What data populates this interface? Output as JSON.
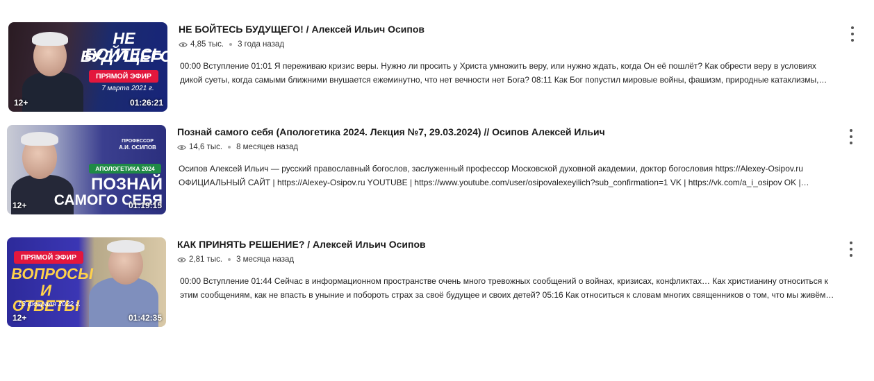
{
  "videos": [
    {
      "title": "НЕ БОЙТЕСЬ БУДУЩЕГО! / Алексей Ильич Осипов",
      "views": "4,85 тыс.",
      "age": "3 года назад",
      "desc_line1": "00:00 Вступление 01:01 Я переживаю кризис веры. Нужно ли просить у Христа умножить веру, или нужно ждать, когда Он её пошлёт? Как обрести веру в условиях",
      "desc_line2": "дикой суеты, когда самыми ближними внушается ежеминутно, что нет вечности нет Бога? 08:11 Как Бог попустил мировые войны, фашизм, природные катаклизмы,…",
      "age_rating": "12+",
      "duration": "01:26:21",
      "thumb_text_1": "НЕ БОЙТЕСЬ",
      "thumb_text_2": "БУДУЩЕГО!",
      "thumb_pill": "ПРЯМОЙ ЭФИР",
      "thumb_date": "7 марта 2021 г."
    },
    {
      "title": "Познай самого себя (Апологетика 2024. Лекция №7, 29.03.2024) // Осипов Алексей Ильич",
      "views": "14,6 тыс.",
      "age": "8 месяцев назад",
      "desc_line1": "Осипов Алексей Ильич — русский православный богослов, заслуженный профессор Московской духовной академии, доктор богословия https://Alexey-Osipov.ru",
      "desc_line2": "ОФИЦИАЛЬНЫЙ САЙТ | https://Alexey-Osipov.ru YOUTUBE | https://www.youtube.com/user/osipovalexeyilich?sub_confirmation=1 VK | https://vk.com/a_i_osipov OK |…",
      "age_rating": "12+",
      "duration": "01:19:15",
      "thumb_prof_1": "ПРОФЕССОР",
      "thumb_prof_2": "А.И. ОСИПОВ",
      "thumb_pill": "АПОЛОГЕТИКА 2024",
      "thumb_text_1": "ПОЗНАЙ",
      "thumb_text_2": "САМОГО СЕБЯ"
    },
    {
      "title": "КАК ПРИНЯТЬ РЕШЕНИЕ? / Алексей Ильич Осипов",
      "views": "2,81 тыс.",
      "age": "3 месяца назад",
      "desc_line1": "00:00 Вступление 01:44 Сейчас в информационном пространстве очень много тревожных сообщений о войнах, кризисах, конфликтах… Как христианину относиться к",
      "desc_line2": "этим сообщениям, как не впасть в уныние и побороть страх за своё будущее и своих детей? 05:16 Как относиться к словам многих священников о том, что мы живём…",
      "age_rating": "12+",
      "duration": "01:42:35",
      "thumb_pill": "ПРЯМОЙ ЭФИР",
      "thumb_text_1": "ВОПРОСЫ",
      "thumb_text_2": "И ОТВЕТЫ",
      "thumb_date": "13 февраля 2022 г."
    }
  ],
  "icons": {
    "views": "eye-icon",
    "menu": "more-vertical-icon"
  },
  "colors": {
    "live_pill": "#e3173d",
    "apologetics_pill": "#1f8a46"
  }
}
